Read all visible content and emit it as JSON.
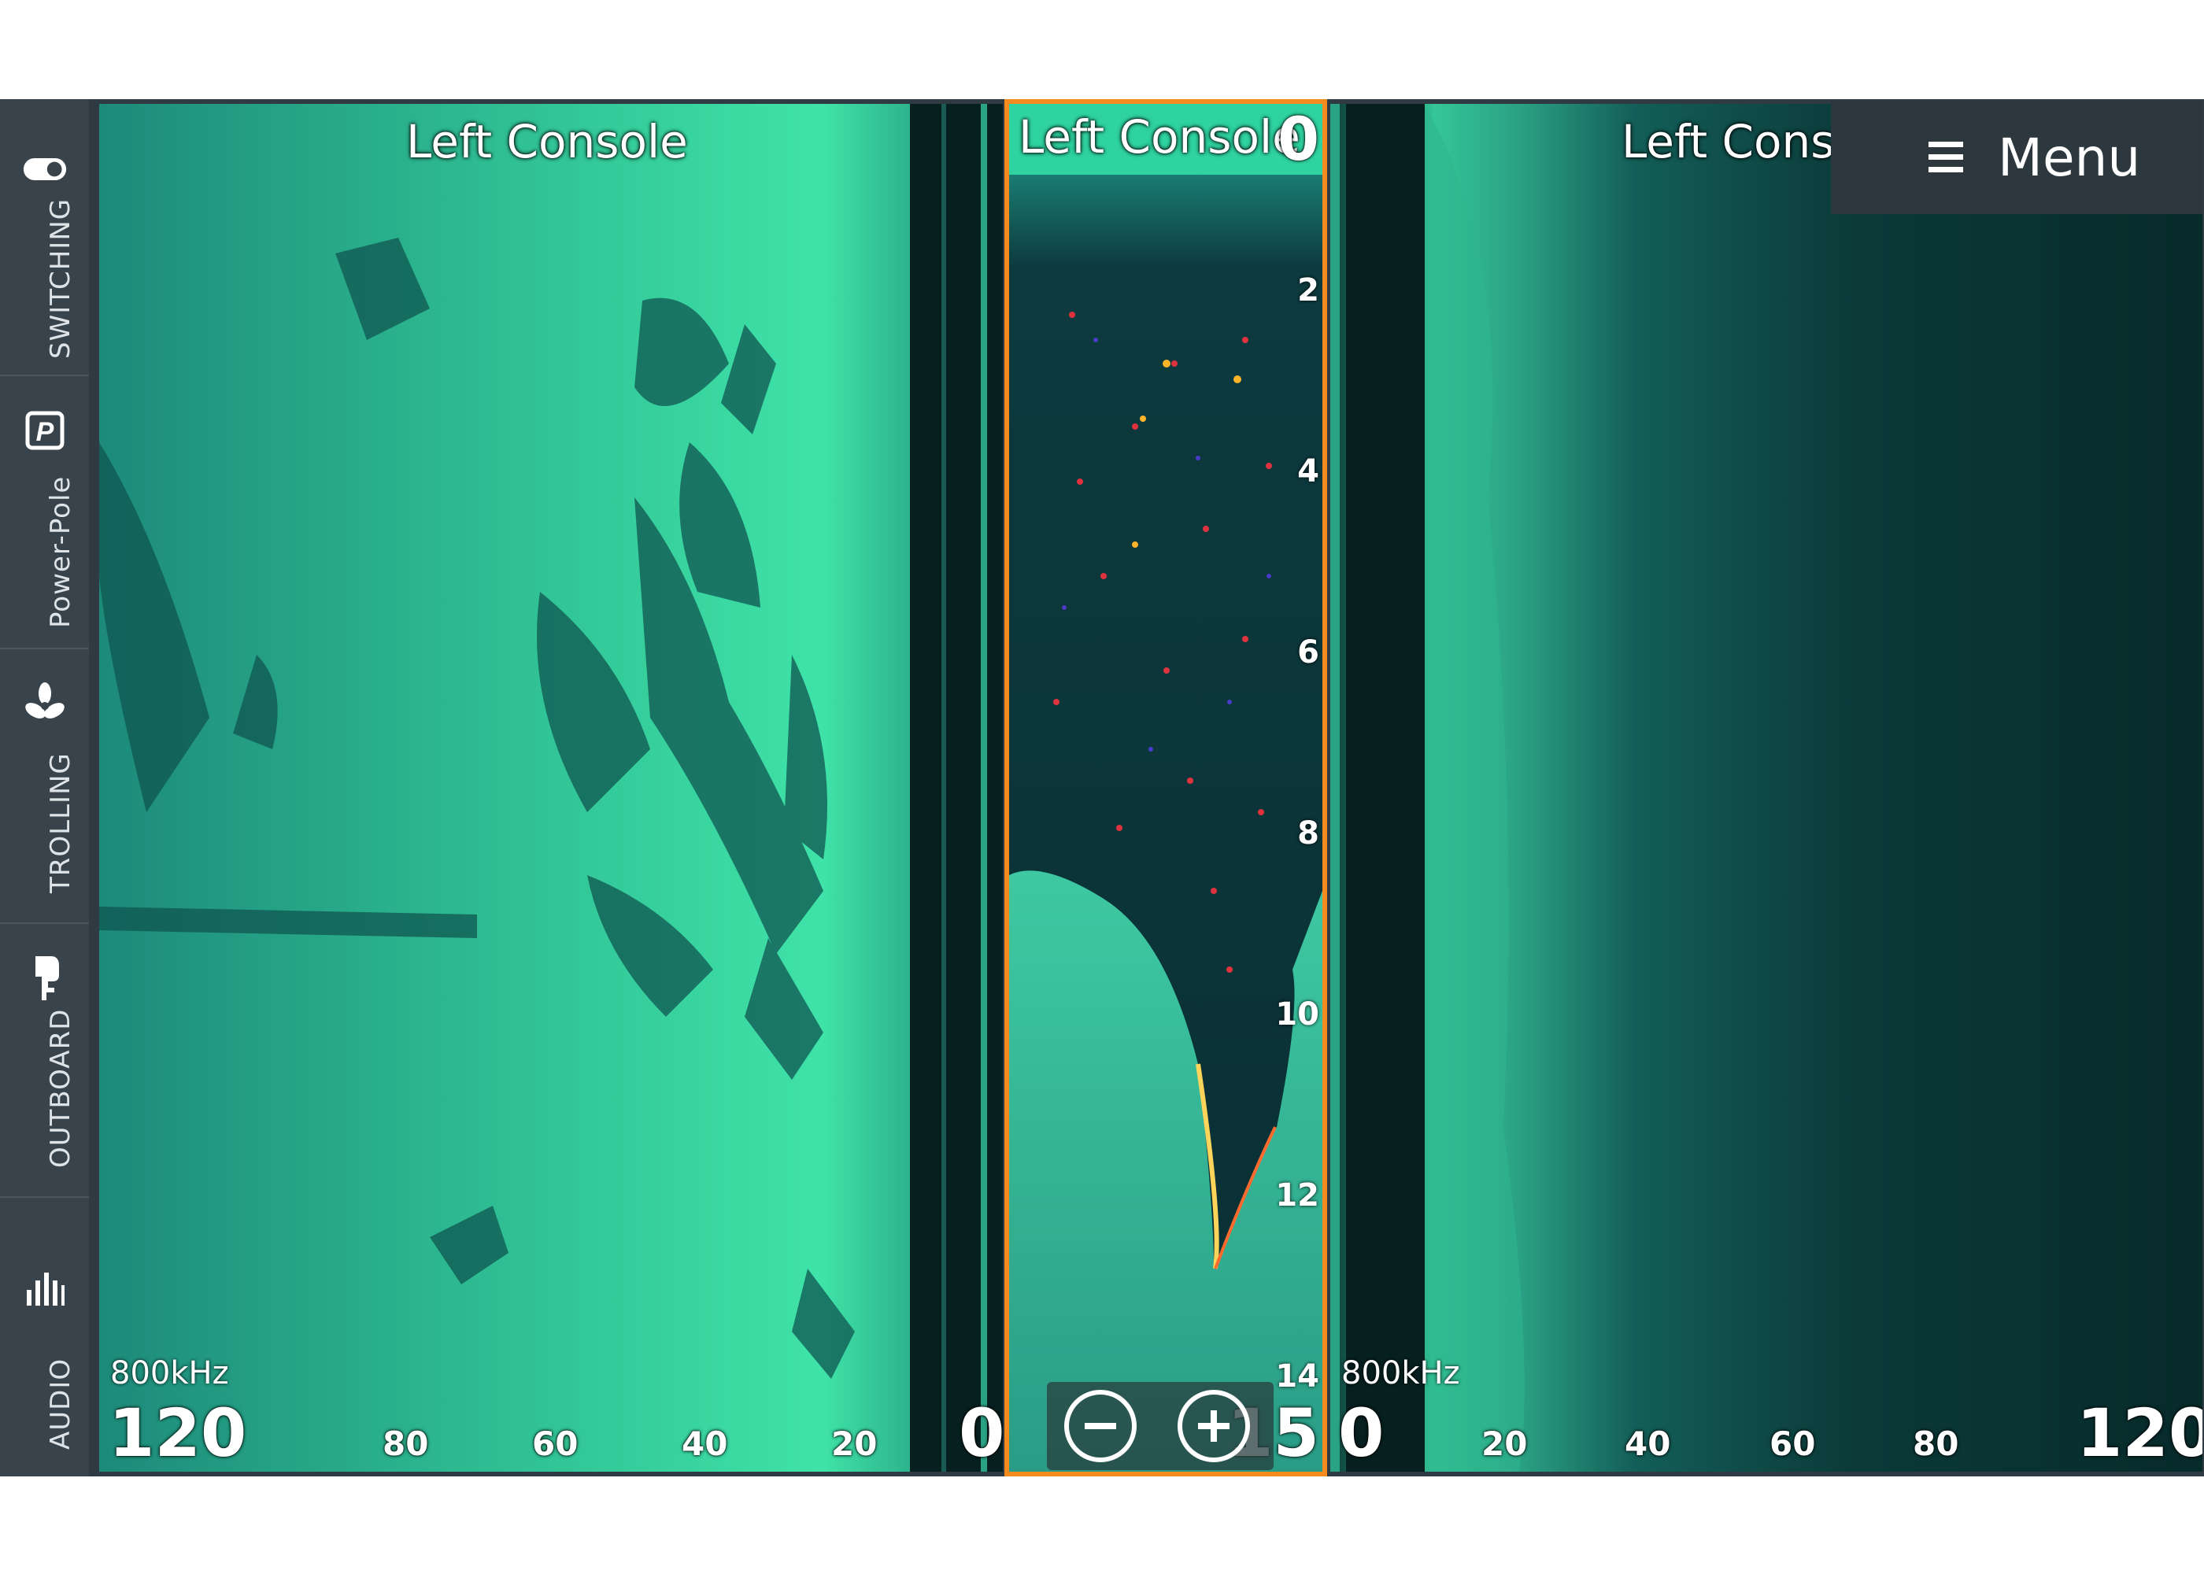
{
  "sidebar": {
    "items": [
      {
        "label": "SWITCHING",
        "icon": "toggle-switch-icon"
      },
      {
        "label": "Power-Pole",
        "icon": "power-pole-icon"
      },
      {
        "label": "TROLLING",
        "icon": "propeller-icon"
      },
      {
        "label": "OUTBOARD",
        "icon": "outboard-motor-icon"
      },
      {
        "label": "AUDIO",
        "icon": "audio-bars-icon"
      }
    ]
  },
  "left_panel": {
    "title": "Left Console",
    "frequency": "800kHz",
    "range_max": "120",
    "ticks": [
      "80",
      "60",
      "40",
      "20"
    ],
    "range_zero": "0"
  },
  "center_panel": {
    "title": "Left Console",
    "depth_top": "0",
    "depth_ticks": [
      "2",
      "4",
      "6",
      "8",
      "10",
      "12",
      "14"
    ],
    "depth_bottom": "15",
    "zoom_out_icon": "minus-circle-icon",
    "zoom_in_icon": "plus-circle-icon"
  },
  "right_panel": {
    "title": "Left Console",
    "frequency": "800kHz",
    "range_zero": "0",
    "ticks": [
      "20",
      "40",
      "60",
      "80"
    ],
    "range_max": "120"
  },
  "menu": {
    "label": "Menu",
    "icon": "hamburger-icon"
  },
  "colors": {
    "sonar_bright": "#3ee0a6",
    "sonar_dark": "#06282a",
    "active_border": "#f58a1f",
    "sidebar_bg": "#38434b"
  }
}
